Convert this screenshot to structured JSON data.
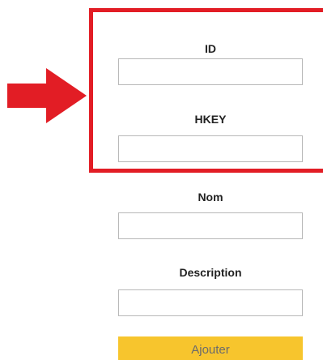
{
  "form": {
    "id_label": "ID",
    "id_value": "",
    "hkey_label": "HKEY",
    "hkey_value": "",
    "nom_label": "Nom",
    "nom_value": "",
    "description_label": "Description",
    "description_value": "",
    "submit_label": "Ajouter"
  },
  "annotation": {
    "highlight_color": "#e21d25",
    "arrow_icon": "right-arrow-icon"
  },
  "colors": {
    "button_background": "#f7c52d",
    "button_text": "#6b6b6b"
  }
}
